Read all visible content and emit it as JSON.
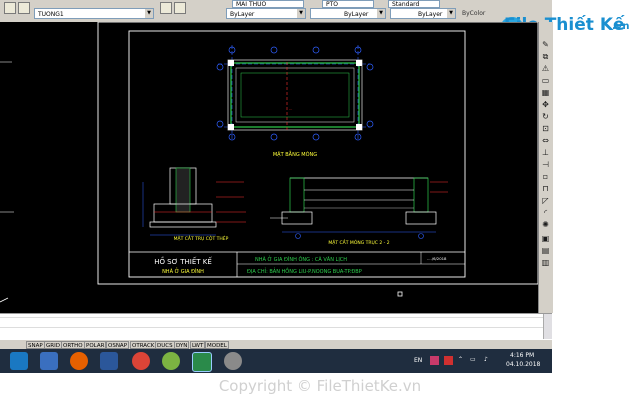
{
  "toolbar": {
    "layer_name": "TUONG1",
    "layer_top": "MAI THUO",
    "linetype_top": "PTO",
    "dimstyle_top": "Standard",
    "color": "ByLayer",
    "linetype": "ByLayer",
    "lineweight": "ByLayer",
    "plotstyle": "ByColor"
  },
  "brand": {
    "name": "File Thiết Kế",
    "suffix": ".vn"
  },
  "drawing": {
    "plan_label": "MẶT BẰNG MÓNG",
    "section_column_label": "MẶT CẮT TRỤ CỘT THÉP",
    "section_foundation_label": "MẶT CẮT MÓNG TRỤC 2 - 2",
    "title_block": {
      "title": "HỒ SƠ THIẾT KẾ",
      "subtitle": "NHÀ Ở GIA ĐÌNH",
      "owner": "NHÀ Ở GIA ĐÌNH ÔNG : CÀ VĂN LỊCH",
      "address": "ĐỊA CHỈ: BẢN HỒNG LIU-P.NOONG BUA-TP.ĐBP",
      "date": "..../6/2018"
    }
  },
  "statusbar": {
    "buttons": [
      "SNAP",
      "GRID",
      "ORTHO",
      "POLAR",
      "OSNAP",
      "OTRACK",
      "DUCS",
      "DYN",
      "LWT",
      "MODEL"
    ]
  },
  "tray": {
    "lang": "EN",
    "time": "4:16 PM",
    "date": "04.10.2018"
  },
  "copyright": "Copyright © FileThietKe.vn"
}
